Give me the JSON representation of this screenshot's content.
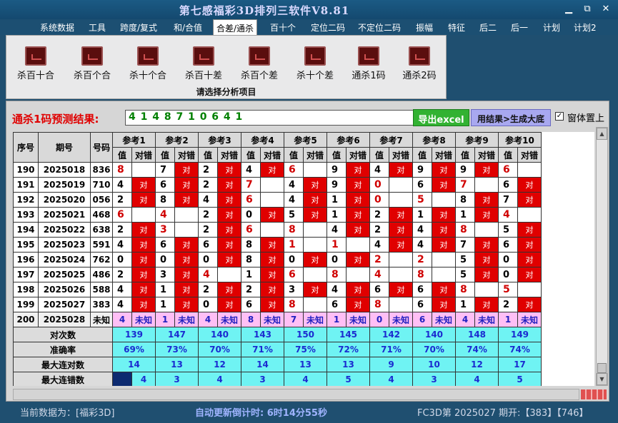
{
  "app": {
    "title": "第七感福彩3D排列三软件V8.81"
  },
  "window": {
    "minimize": "▁",
    "restore": "⧉",
    "close": "✕"
  },
  "menu": {
    "items": [
      "系统数据",
      "工具",
      "跨度/复式",
      "和/合值",
      "合差/通杀",
      "百十个",
      "定位二码",
      "不定位二码",
      "振幅",
      "特征",
      "后二",
      "后一",
      "计划",
      "计划2"
    ],
    "active_index": 4
  },
  "ribbon": {
    "caption": "请选择分析项目",
    "buttons": [
      "杀百十合",
      "杀百个合",
      "杀十个合",
      "杀百十差",
      "杀百个差",
      "杀十个差",
      "通杀1码",
      "通杀2码"
    ]
  },
  "prediction": {
    "label": "通杀1码预测结果:",
    "value": "4 1 4 8 7 1 0 6 4 1",
    "export_label": "导出excel",
    "generate_label": "用结果>生成大底",
    "always_on_top_label": "窗体置上",
    "always_on_top_checked": true
  },
  "table": {
    "col_xuhao": "序号",
    "col_qihao": "期号",
    "col_haoma": "号码",
    "refs": [
      "参考1",
      "参考2",
      "参考3",
      "参考4",
      "参考5",
      "参考6",
      "参考7",
      "参考8",
      "参考9",
      "参考10"
    ],
    "sub_value": "值",
    "sub_result": "对错",
    "right_mark": "对",
    "unknown_mark": "未知",
    "rows": [
      {
        "no": "190",
        "issue": "2025018",
        "num": "836",
        "v": [
          "8",
          "7",
          "2",
          "4",
          "6",
          "9",
          "4",
          "9",
          "9",
          "6"
        ],
        "r": [
          0,
          1,
          1,
          1,
          0,
          1,
          1,
          1,
          1,
          0
        ]
      },
      {
        "no": "191",
        "issue": "2025019",
        "num": "710",
        "v": [
          "4",
          "6",
          "2",
          "7",
          "4",
          "9",
          "0",
          "6",
          "7",
          "6"
        ],
        "r": [
          1,
          1,
          1,
          0,
          1,
          1,
          0,
          1,
          0,
          1
        ]
      },
      {
        "no": "192",
        "issue": "2025020",
        "num": "056",
        "v": [
          "2",
          "8",
          "4",
          "6",
          "4",
          "1",
          "0",
          "5",
          "8",
          "7"
        ],
        "r": [
          1,
          1,
          1,
          0,
          1,
          1,
          0,
          0,
          1,
          1
        ]
      },
      {
        "no": "193",
        "issue": "2025021",
        "num": "468",
        "v": [
          "6",
          "4",
          "2",
          "0",
          "5",
          "1",
          "2",
          "1",
          "1",
          "4"
        ],
        "r": [
          0,
          0,
          1,
          1,
          1,
          1,
          1,
          1,
          1,
          0
        ]
      },
      {
        "no": "194",
        "issue": "2025022",
        "num": "638",
        "v": [
          "2",
          "3",
          "2",
          "6",
          "8",
          "4",
          "2",
          "4",
          "8",
          "5"
        ],
        "r": [
          1,
          0,
          1,
          0,
          0,
          1,
          1,
          1,
          0,
          1
        ]
      },
      {
        "no": "195",
        "issue": "2025023",
        "num": "591",
        "v": [
          "4",
          "6",
          "6",
          "8",
          "1",
          "1",
          "4",
          "4",
          "7",
          "6"
        ],
        "r": [
          1,
          1,
          1,
          1,
          0,
          0,
          1,
          1,
          1,
          1
        ]
      },
      {
        "no": "196",
        "issue": "2025024",
        "num": "762",
        "v": [
          "0",
          "0",
          "0",
          "8",
          "0",
          "0",
          "2",
          "2",
          "5",
          "0"
        ],
        "r": [
          1,
          1,
          1,
          1,
          1,
          1,
          0,
          0,
          1,
          1
        ]
      },
      {
        "no": "197",
        "issue": "2025025",
        "num": "486",
        "v": [
          "2",
          "3",
          "4",
          "1",
          "6",
          "8",
          "4",
          "8",
          "5",
          "0"
        ],
        "r": [
          1,
          1,
          0,
          1,
          0,
          0,
          0,
          0,
          1,
          1
        ]
      },
      {
        "no": "198",
        "issue": "2025026",
        "num": "588",
        "v": [
          "4",
          "1",
          "2",
          "2",
          "3",
          "4",
          "6",
          "6",
          "8",
          "5"
        ],
        "r": [
          1,
          1,
          1,
          1,
          1,
          1,
          1,
          1,
          0,
          0
        ]
      },
      {
        "no": "199",
        "issue": "2025027",
        "num": "383",
        "v": [
          "4",
          "1",
          "0",
          "6",
          "8",
          "6",
          "8",
          "6",
          "1",
          "2"
        ],
        "r": [
          1,
          1,
          1,
          1,
          0,
          1,
          0,
          1,
          1,
          1
        ]
      }
    ],
    "pending": {
      "no": "200",
      "issue": "2025028",
      "num": "未知",
      "v": [
        "4",
        "1",
        "4",
        "8",
        "7",
        "1",
        "0",
        "6",
        "4",
        "1"
      ]
    },
    "stats": [
      {
        "label": "对次数",
        "values": [
          "139",
          "147",
          "140",
          "143",
          "150",
          "145",
          "142",
          "140",
          "148",
          "149"
        ]
      },
      {
        "label": "准确率",
        "values": [
          "69%",
          "73%",
          "70%",
          "71%",
          "75%",
          "72%",
          "71%",
          "70%",
          "74%",
          "74%"
        ]
      },
      {
        "label": "最大连对数",
        "values": [
          "14",
          "13",
          "12",
          "14",
          "13",
          "13",
          "9",
          "10",
          "12",
          "17"
        ]
      },
      {
        "label": "最大连错数",
        "values": [
          "4",
          "3",
          "4",
          "3",
          "4",
          "5",
          "4",
          "3",
          "4",
          "5"
        ]
      }
    ]
  },
  "status": {
    "data_source": "当前数据为：[福彩3D]",
    "countdown": "自动更新倒计时:  6时14分55秒",
    "draw_info": "FC3D第 2025027 期开:【383】【746】"
  },
  "colors": {
    "error": "#e00000",
    "stats": "#6ff3f3",
    "unknown": "#ffbff5",
    "accent": "#1f4f70"
  }
}
